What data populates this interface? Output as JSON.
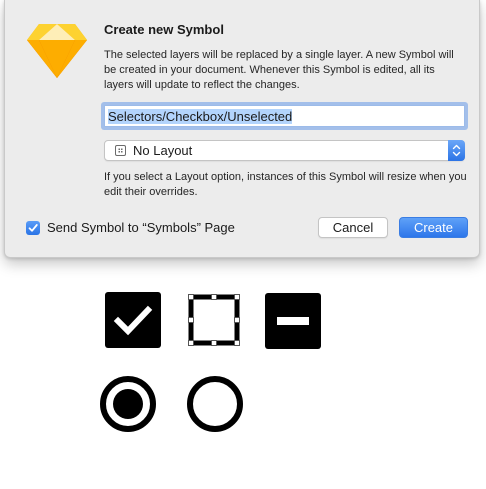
{
  "dialog": {
    "title": "Create new Symbol",
    "description": "The selected layers will be replaced by a single layer. A new Symbol will be created in your document. Whenever this Symbol is edited, all its layers will update to reflect the changes.",
    "name_value": "Selectors/Checkbox/Unselected",
    "layout_select": {
      "selected": "No Layout",
      "icon": "layout-grid-icon"
    },
    "hint": "If you select a Layout option, instances of this Symbol will resize when you edit their overrides.",
    "send_to_symbols_page": {
      "label": "Send Symbol to “Symbols” Page",
      "checked": true
    },
    "buttons": {
      "cancel": "Cancel",
      "create": "Create"
    },
    "app_icon": "sketch-diamond-icon"
  },
  "canvas": {
    "symbols": [
      {
        "name": "checkbox-checked",
        "icon": "checkmark-icon"
      },
      {
        "name": "checkbox-unselected",
        "selected": true
      },
      {
        "name": "checkbox-indeterminate",
        "icon": "minus-icon"
      },
      {
        "name": "radio-selected"
      },
      {
        "name": "radio-unselected"
      }
    ]
  },
  "colors": {
    "accent": "#2d76ea",
    "dialog_bg": "#ececec",
    "sketch_orange": "#f7a51e"
  }
}
